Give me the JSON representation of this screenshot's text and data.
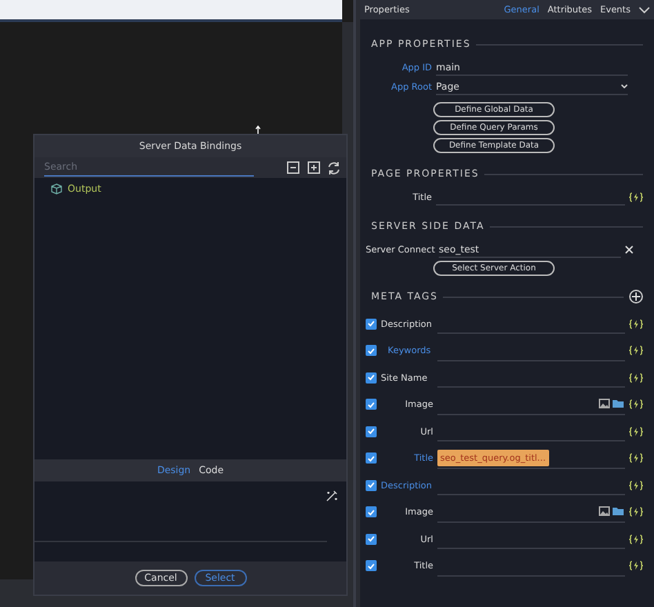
{
  "dialog": {
    "title": "Server Data Bindings",
    "search": {
      "placeholder": "Search"
    },
    "tree": [
      {
        "label": "Output"
      }
    ],
    "tabs": [
      {
        "label": "Design",
        "selected": true
      },
      {
        "label": "Code",
        "selected": false
      }
    ],
    "buttons": [
      {
        "label": "Cancel",
        "kind": "secondary"
      },
      {
        "label": "Select",
        "kind": "primary"
      }
    ]
  },
  "properties": {
    "title": "Properties",
    "tabs": [
      {
        "label": "General",
        "selected": true
      },
      {
        "label": "Attributes",
        "selected": false
      },
      {
        "label": "Events",
        "selected": false
      }
    ],
    "app": {
      "heading": "APP PROPERTIES",
      "app_id": {
        "label": "App ID",
        "value": "main"
      },
      "app_root": {
        "label": "App Root",
        "value": "Page"
      },
      "buttons": [
        "Define Global Data",
        "Define Query Params",
        "Define Template Data"
      ]
    },
    "page": {
      "heading": "PAGE PROPERTIES",
      "title_label": "Title"
    },
    "server": {
      "heading": "SERVER SIDE DATA",
      "label": "Server Connect",
      "value": "seo_test",
      "button": "Select Server Action"
    },
    "meta": {
      "heading": "META TAGS",
      "rows": [
        {
          "label": "Description",
          "kind": "text",
          "right_aligned": false,
          "indented": false,
          "highlighted": false,
          "checked": true
        },
        {
          "label": "Keywords",
          "kind": "text",
          "right_aligned": false,
          "indented": true,
          "highlighted": true,
          "checked": true
        },
        {
          "label": "Site Name",
          "kind": "text",
          "right_aligned": false,
          "indented": false,
          "highlighted": false,
          "checked": true
        },
        {
          "label": "Image",
          "kind": "image",
          "right_aligned": true,
          "indented": false,
          "highlighted": false,
          "checked": true
        },
        {
          "label": "Url",
          "kind": "text",
          "right_aligned": true,
          "indented": false,
          "highlighted": false,
          "checked": true
        },
        {
          "label": "Title",
          "kind": "text",
          "right_aligned": true,
          "indented": false,
          "highlighted": true,
          "checked": true,
          "value": "seo_test_query.og_titl..."
        },
        {
          "label": "Description",
          "kind": "text",
          "right_aligned": false,
          "indented": false,
          "highlighted": true,
          "checked": true
        },
        {
          "label": "Image",
          "kind": "image",
          "right_aligned": true,
          "indented": false,
          "highlighted": false,
          "checked": true
        },
        {
          "label": "Url",
          "kind": "text",
          "right_aligned": true,
          "indented": false,
          "highlighted": false,
          "checked": true
        },
        {
          "label": "Title",
          "kind": "text",
          "right_aligned": true,
          "indented": false,
          "highlighted": false,
          "checked": true
        }
      ]
    }
  }
}
